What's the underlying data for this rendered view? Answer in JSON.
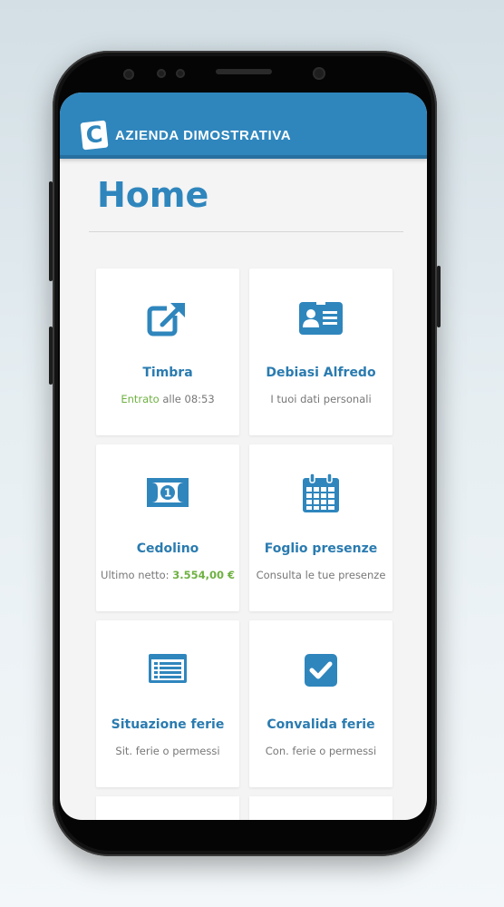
{
  "header": {
    "logo_letter": "C",
    "company": "AZIENDA DIMOSTRATIVA"
  },
  "page": {
    "title": "Home"
  },
  "cards": [
    {
      "title": "Timbra",
      "sub_status": "Entrato",
      "sub_rest": " alle 08:53",
      "icon": "external-link-icon"
    },
    {
      "title": "Debiasi Alfredo",
      "sub": "I tuoi dati personali",
      "icon": "id-card-icon"
    },
    {
      "title": "Cedolino",
      "sub_prefix": "Ultimo netto: ",
      "sub_amount": "3.554,00 €",
      "icon": "money-bill-icon"
    },
    {
      "title": "Foglio presenze",
      "sub": "Consulta le tue presenze",
      "icon": "calendar-icon"
    },
    {
      "title": "Situazione ferie",
      "sub": "Sit. ferie o permessi",
      "icon": "list-icon"
    },
    {
      "title": "Convalida ferie",
      "sub": "Con. ferie o permessi",
      "icon": "check-square-icon"
    }
  ],
  "colors": {
    "accent": "#2f86bd",
    "positive": "#6fb142",
    "muted": "#777777"
  }
}
